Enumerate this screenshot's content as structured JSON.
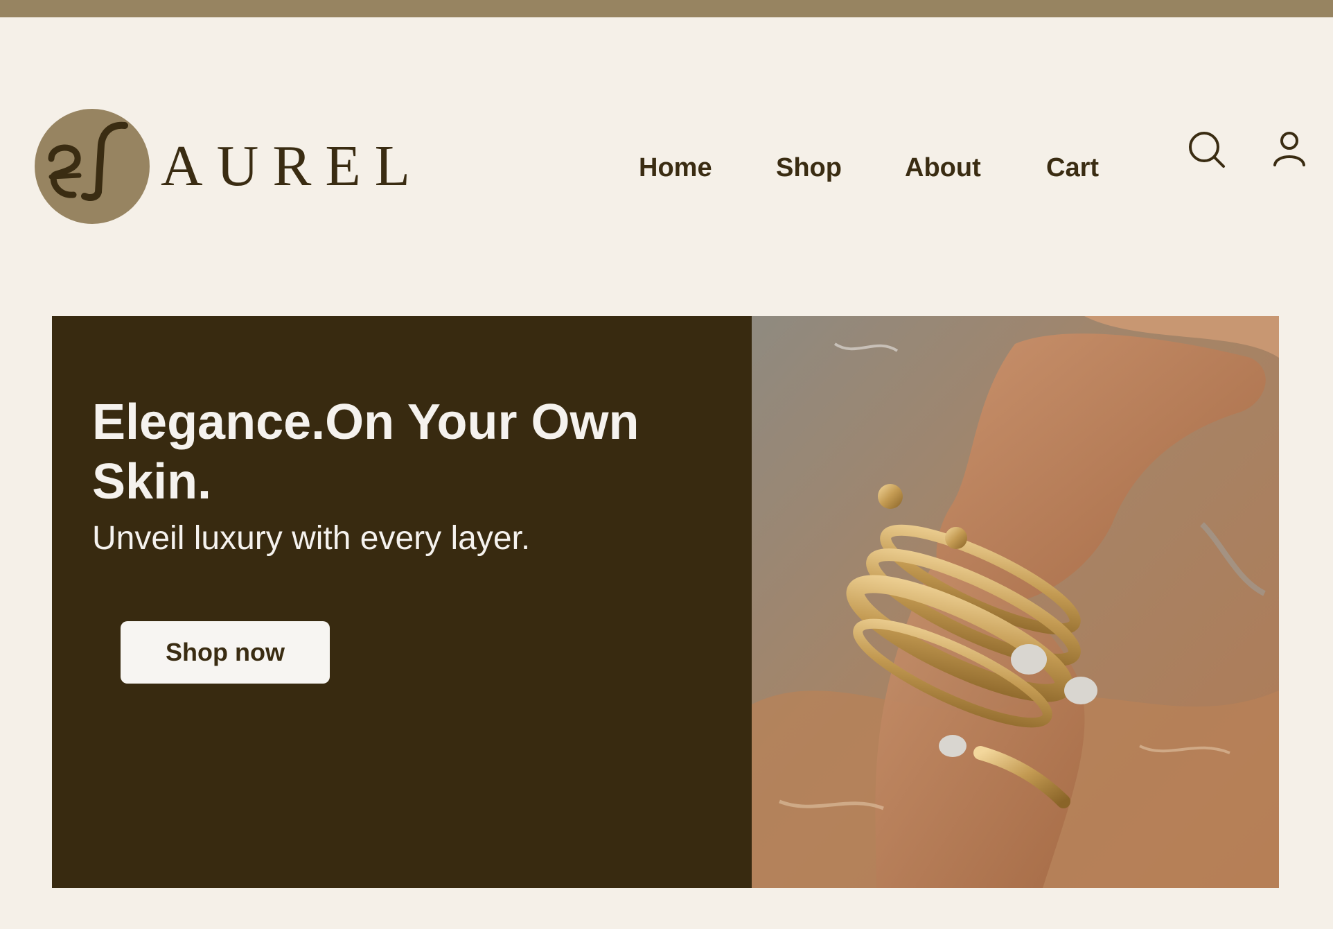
{
  "brand": {
    "logo_monogram": "el",
    "name": "AUREL"
  },
  "nav": {
    "items": [
      {
        "label": "Home"
      },
      {
        "label": "Shop"
      },
      {
        "label": "About"
      },
      {
        "label": "Cart"
      }
    ],
    "search_icon": "search-icon",
    "account_icon": "user-icon"
  },
  "hero": {
    "title": "Elegance.On Your Own Skin.",
    "subtitle": "Unveil luxury with every layer.",
    "cta_label": "Shop now",
    "image_alt": "Gold bracelets on wrist in water"
  },
  "colors": {
    "accent": "#978461",
    "background": "#f5f0e8",
    "hero_dark": "#382a10",
    "text_dark": "#3a2c12"
  }
}
